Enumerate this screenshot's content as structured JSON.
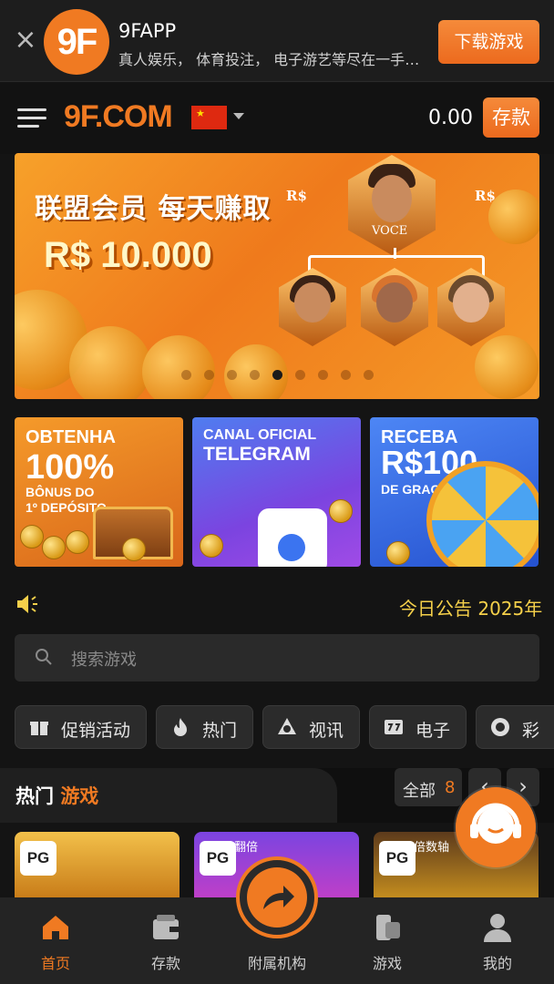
{
  "top_banner": {
    "app_logo": "9F",
    "app_name": "9FAPP",
    "app_desc": "真人娱乐， 体育投注， 电子游艺等尽在一手掌握",
    "download_label": "下载游戏"
  },
  "header": {
    "logo": "9F.COM",
    "balance": "0.00",
    "deposit_label": "存款",
    "language_flag": "china-flag"
  },
  "hero": {
    "title": "联盟会员 每天赚取",
    "amount": "R$ 10.000",
    "top_label": "VOCE",
    "currency_tag": "R$",
    "slide_count": 9,
    "active_slide": 5
  },
  "promo_cards": [
    {
      "line1": "OBTENHA",
      "line2": "100%",
      "line3": "BÔNUS DO",
      "line4": "1º DEPÓSITO"
    },
    {
      "line1": "CANAL OFICIAL",
      "line2": "TELEGRAM"
    },
    {
      "line1": "RECEBA",
      "line2": "R$100",
      "line3": "DE GRAÇA"
    }
  ],
  "notice": {
    "text": "今日公告 2025年"
  },
  "search": {
    "placeholder": "搜索游戏"
  },
  "categories": [
    {
      "label": "促销活动",
      "icon": "gift-icon"
    },
    {
      "label": "热门",
      "icon": "fire-icon"
    },
    {
      "label": "视讯",
      "icon": "poker-chip-icon"
    },
    {
      "label": "电子",
      "icon": "slot-777-icon"
    },
    {
      "label": "彩",
      "icon": "lottery-ball-icon"
    }
  ],
  "hot_games": {
    "title_a": "热门",
    "title_b": "游戏",
    "all_label": "全部",
    "all_count": "8",
    "games": [
      {
        "provider": "PG",
        "tag": ""
      },
      {
        "provider": "PG",
        "tag": "翻倍"
      },
      {
        "provider": "PG",
        "tag": "倍数轴"
      }
    ]
  },
  "bottom_nav": [
    {
      "label": "首页",
      "icon": "home-icon",
      "active": true
    },
    {
      "label": "存款",
      "icon": "wallet-icon",
      "active": false
    },
    {
      "label": "附属机构",
      "icon": "share-arrow-icon",
      "active": false
    },
    {
      "label": "游戏",
      "icon": "gamepad-icon",
      "active": false
    },
    {
      "label": "我的",
      "icon": "user-icon",
      "active": false
    }
  ],
  "colors": {
    "accent": "#f07a22",
    "notice": "#f5d04a",
    "background": "#141414"
  }
}
